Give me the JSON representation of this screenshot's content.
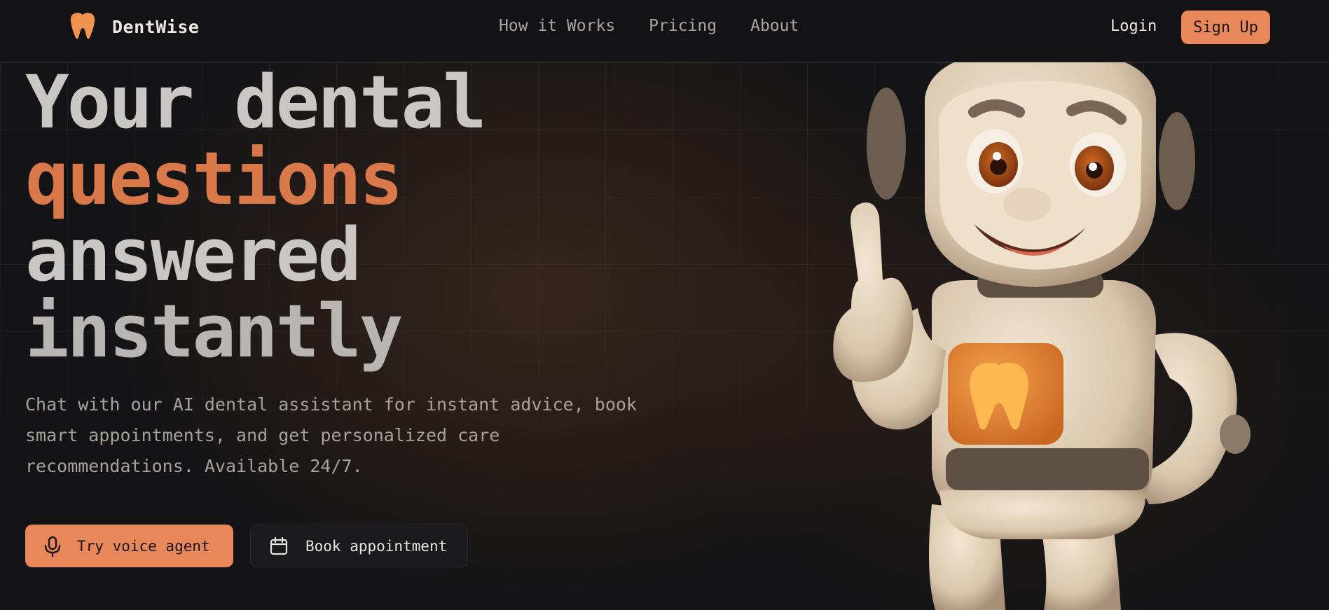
{
  "header": {
    "brand_name": "DentWise",
    "logo_icon": "tooth-icon",
    "nav": [
      {
        "label": "How it Works"
      },
      {
        "label": "Pricing"
      },
      {
        "label": "About"
      }
    ],
    "login_label": "Login",
    "signup_label": "Sign Up"
  },
  "hero": {
    "title_line1": "Your dental",
    "title_line2": "questions",
    "title_line3": "answered",
    "title_line4": "instantly",
    "description": "Chat with our AI dental assistant for instant advice, book smart appointments, and get personalized care recommendations. Available 24/7.",
    "primary_button": {
      "label": "Try voice agent",
      "icon": "microphone-icon"
    },
    "secondary_button": {
      "label": "Book appointment",
      "icon": "calendar-icon"
    }
  },
  "colors": {
    "accent": "#e8875a",
    "accent_text": "#d9794a",
    "background": "#141416"
  }
}
